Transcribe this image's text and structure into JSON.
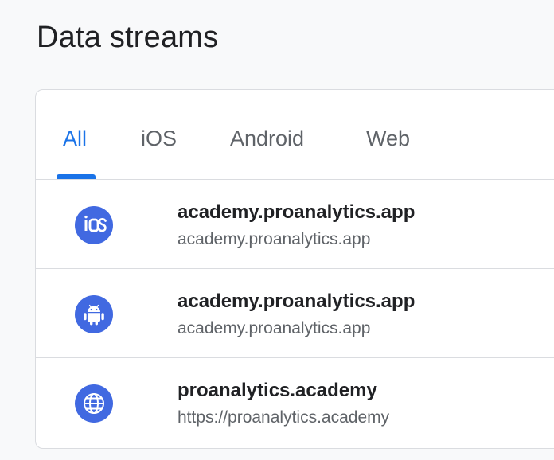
{
  "page": {
    "title": "Data streams"
  },
  "tabs": [
    {
      "label": "All",
      "active": true
    },
    {
      "label": "iOS",
      "active": false
    },
    {
      "label": "Android",
      "active": false
    },
    {
      "label": "Web",
      "active": false
    }
  ],
  "streams": [
    {
      "platform": "iOS",
      "icon": "ios-icon",
      "name": "academy.proanalytics.app",
      "url": "academy.proanalytics.app"
    },
    {
      "platform": "Android",
      "icon": "android-icon",
      "name": "academy.proanalytics.app",
      "url": "academy.proanalytics.app"
    },
    {
      "platform": "Web",
      "icon": "globe-icon",
      "name": "proanalytics.academy",
      "url": "https://proanalytics.academy"
    }
  ],
  "colors": {
    "accent": "#1a73e8",
    "icon_background": "#4169e1",
    "tab_text": "#5f6368",
    "divider": "#dadce0"
  }
}
